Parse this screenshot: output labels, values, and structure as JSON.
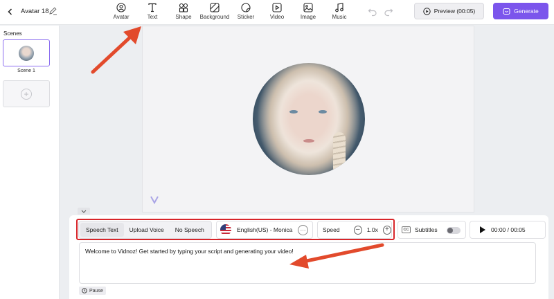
{
  "header": {
    "title": "Avatar 18",
    "tools": [
      {
        "label": "Avatar",
        "icon": "avatar-icon"
      },
      {
        "label": "Text",
        "icon": "text-icon"
      },
      {
        "label": "Shape",
        "icon": "shape-icon"
      },
      {
        "label": "Background",
        "icon": "background-icon"
      },
      {
        "label": "Sticker",
        "icon": "sticker-icon"
      },
      {
        "label": "Video",
        "icon": "video-icon"
      },
      {
        "label": "Image",
        "icon": "image-icon"
      },
      {
        "label": "Music",
        "icon": "music-icon"
      }
    ],
    "preview_label": "Preview (00:05)",
    "generate_label": "Generate",
    "accent_color": "#7b55ec"
  },
  "sidebar": {
    "heading": "Scenes",
    "scenes": [
      {
        "label": "Scene 1"
      }
    ]
  },
  "speech": {
    "modes": [
      "Speech Text",
      "Upload Voice",
      "No Speech"
    ],
    "active_mode": "Speech Text",
    "voice": "English(US) - Monica",
    "speed_label": "Speed",
    "speed_value": "1.0x",
    "subtitles_label": "Subtitles",
    "subtitles_on": false,
    "time": "00:00 / 00:05",
    "script": "Welcome to Vidnoz! Get started by typing your script and generating your video!",
    "pause_label": "Pause"
  },
  "annotation_color": "#e24a2c"
}
